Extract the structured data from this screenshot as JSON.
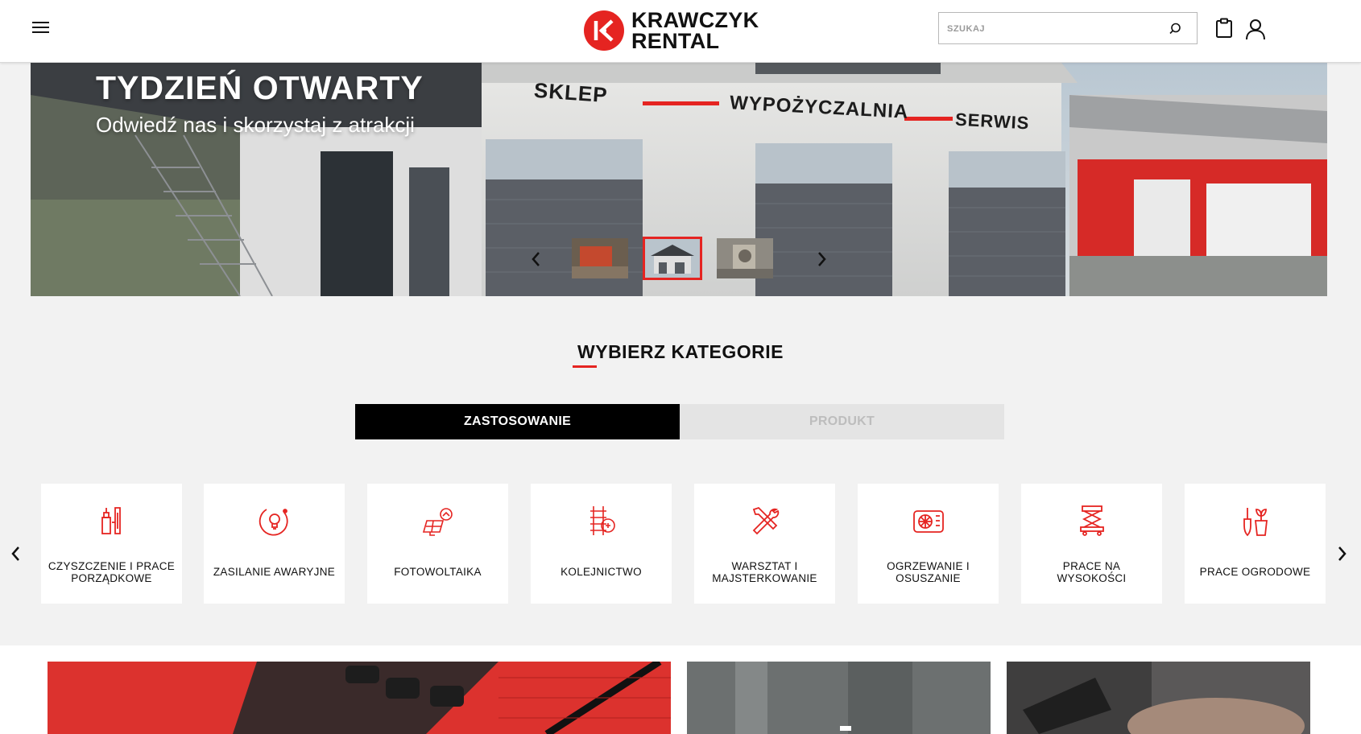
{
  "header": {
    "logo_line1": "KRAWCZYK",
    "logo_line2": "RENTAL",
    "search_placeholder": "SZUKAJ",
    "icons": [
      "menu-icon",
      "search-icon",
      "clipboard-icon",
      "user-icon"
    ]
  },
  "hero": {
    "title": "TYDZIEŃ OTWARTY",
    "subtitle": "Odwiedź nas i skorzystaj z atrakcji",
    "signs": [
      "SKLEP",
      "WYPOŻYCZALNIA",
      "SERWIS"
    ],
    "thumbnails": [
      {
        "name": "thumb-1",
        "active": false
      },
      {
        "name": "thumb-2",
        "active": true
      },
      {
        "name": "thumb-3",
        "active": false
      }
    ]
  },
  "categories": {
    "title": "WYBIERZ KATEGORIE",
    "tabs": [
      {
        "label": "ZASTOSOWANIE",
        "active": true
      },
      {
        "label": "PRODUKT",
        "active": false
      }
    ],
    "items": [
      {
        "label": "CZYSZCZENIE I PRACE PORZĄDKOWE",
        "icon": "cleaning-icon"
      },
      {
        "label": "ZASILANIE AWARYJNE",
        "icon": "lightbulb-icon"
      },
      {
        "label": "FOTOWOLTAIKA",
        "icon": "solar-panel-icon"
      },
      {
        "label": "KOLEJNICTWO",
        "icon": "railway-icon"
      },
      {
        "label": "WARSZTAT I MAJSTERKOWANIE",
        "icon": "tools-icon"
      },
      {
        "label": "OGRZEWANIE I OSUSZANIE",
        "icon": "heater-icon"
      },
      {
        "label": "PRACE NA WYSOKOŚCI",
        "icon": "scissor-lift-icon"
      },
      {
        "label": "PRACE OGRODOWE",
        "icon": "plant-icon"
      }
    ]
  },
  "colors": {
    "accent": "#e52421",
    "dark": "#000000",
    "tab_inactive": "#e4e4e4"
  }
}
